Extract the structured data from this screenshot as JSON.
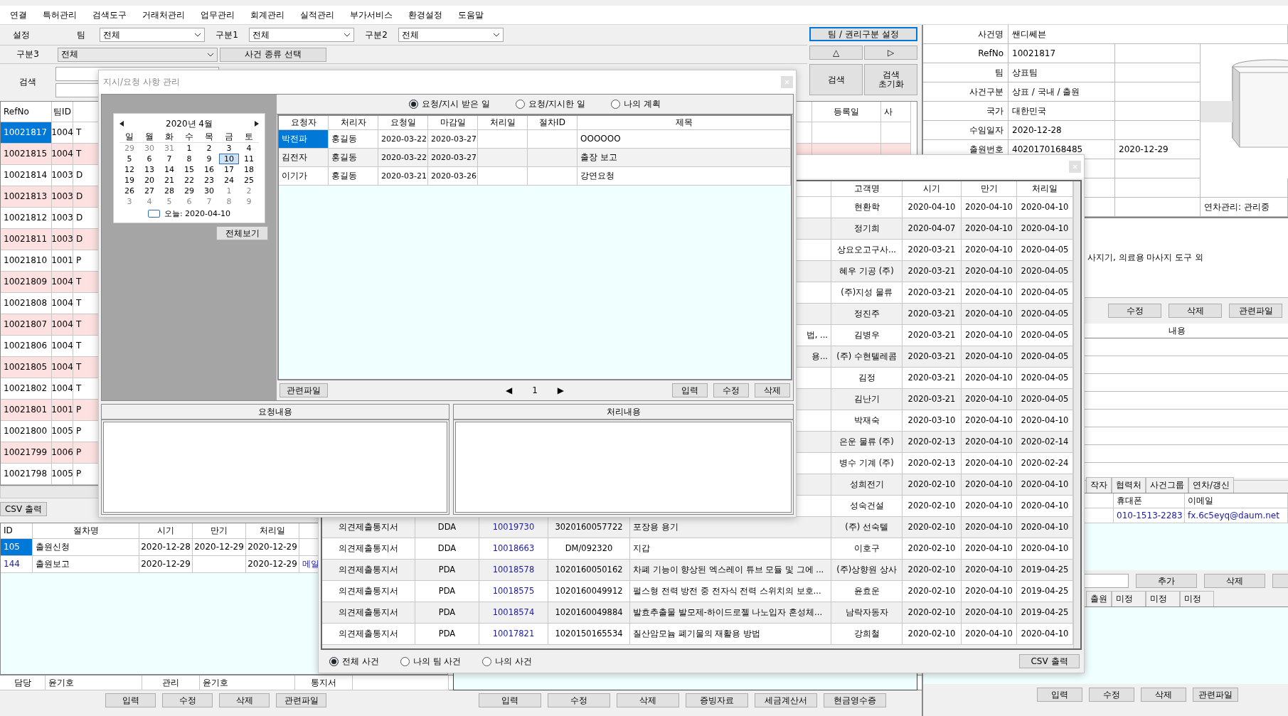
{
  "menu": [
    "연결",
    "특허관리",
    "검색도구",
    "거래처관리",
    "업무관리",
    "회계관리",
    "실적관리",
    "부가서비스",
    "환경설정",
    "도움말"
  ],
  "filters": {
    "settings_label": "설정",
    "team_label": "팀",
    "team_value": "전체",
    "cat1_label": "구분1",
    "cat1_value": "전체",
    "cat2_label": "구분2",
    "cat2_value": "전체",
    "cat3_label": "구분3",
    "cat3_value": "전체",
    "case_type_button": "사건 종류 선택",
    "search_label": "검색"
  },
  "toolbar": {
    "team_rights_button": "팀 / 권리구분 설정",
    "up_button": "△",
    "next_button": "▷",
    "search_button": "검색",
    "reset_button": "검색 초기화"
  },
  "case_table": {
    "columns": [
      "RefNo",
      "팀ID"
    ],
    "right_columns": [
      "등록일",
      "사"
    ],
    "rows": [
      {
        "ref": "10021817",
        "team": "1004",
        "type": "T",
        "selected": true
      },
      {
        "ref": "10021815",
        "team": "1004",
        "type": "T",
        "selected": false
      },
      {
        "ref": "10021814",
        "team": "1003",
        "type": "D",
        "selected": false
      },
      {
        "ref": "10021813",
        "team": "1003",
        "type": "D",
        "selected": false
      },
      {
        "ref": "10021812",
        "team": "1003",
        "type": "D",
        "selected": false
      },
      {
        "ref": "10021811",
        "team": "1003",
        "type": "D",
        "selected": false
      },
      {
        "ref": "10021810",
        "team": "1001",
        "type": "P",
        "selected": false
      },
      {
        "ref": "10021809",
        "team": "1004",
        "type": "T",
        "selected": false
      },
      {
        "ref": "10021808",
        "team": "1004",
        "type": "T",
        "selected": false
      },
      {
        "ref": "10021807",
        "team": "1004",
        "type": "T",
        "selected": false
      },
      {
        "ref": "10021806",
        "team": "1004",
        "type": "T",
        "selected": false
      },
      {
        "ref": "10021805",
        "team": "1004",
        "type": "T",
        "selected": false
      },
      {
        "ref": "10021802",
        "team": "1004",
        "type": "T",
        "selected": false
      },
      {
        "ref": "10021801",
        "team": "1001",
        "type": "P",
        "selected": false
      },
      {
        "ref": "10021800",
        "team": "1005",
        "type": "P",
        "selected": false
      },
      {
        "ref": "10021799",
        "team": "1006",
        "type": "P",
        "selected": false
      },
      {
        "ref": "10021798",
        "team": "1005",
        "type": "P",
        "selected": false
      }
    ]
  },
  "csv_button": "CSV 출력",
  "procedures": {
    "columns": [
      "ID",
      "절차명",
      "시기",
      "만기",
      "처리일"
    ],
    "rows": [
      {
        "id": "105",
        "name": "출원신청",
        "start": "2020-12-28",
        "due": "2020-12-29",
        "done": "2020-12-29",
        "selected": true
      },
      {
        "id": "144",
        "name": "출원보고",
        "start": "2020-12-29",
        "done": "2020-12-29",
        "note": "메일",
        "selected": false
      }
    ]
  },
  "assignment": {
    "owner_label": "담당",
    "owner": "윤기호",
    "manager_label": "관리",
    "manager": "윤기호",
    "notice_label": "통지서"
  },
  "procedure_buttons": [
    "입력",
    "수정",
    "삭제",
    "관련파일"
  ],
  "billing_buttons": [
    "입력",
    "수정",
    "삭제",
    "증빙자료",
    "세금계산서",
    "현금영수증"
  ],
  "case_info": {
    "rows": [
      {
        "label": "사건명",
        "value": "쌘디쎄븐"
      },
      {
        "label": "RefNo",
        "value": "10021817"
      },
      {
        "label": "팀",
        "value": "상표팀"
      },
      {
        "label": "사건구분",
        "value": "상표 / 국내 / 출원"
      },
      {
        "label": "국가",
        "value": "대한민국"
      },
      {
        "label": "수임일자",
        "value": "2020-12-28"
      },
      {
        "label": "출원번호",
        "value": "4020170168485",
        "extra": "2020-12-29"
      }
    ],
    "note": "연차관리: 관리중"
  },
  "description_fragment": "사지기, 의료용 마사지 도구 외",
  "description_buttons": [
    "수정",
    "삭제",
    "관련파일"
  ],
  "content_header": "내용",
  "relation_tabs": [
    "작자",
    "협력처",
    "사건그룹",
    "연차/갱신"
  ],
  "contacts": {
    "columns": [
      "휴대폰",
      "이메일"
    ],
    "rows": [
      {
        "phone": "010-1513-2283",
        "email": "fx.6c5eyq@daum.net"
      }
    ]
  },
  "contact_buttons": [
    "추가",
    "삭제"
  ],
  "status_tabs": [
    "출원",
    "미정",
    "미정",
    "미정"
  ],
  "case_buttons": [
    "입력",
    "수정",
    "삭제",
    "관련파일"
  ],
  "request_dialog": {
    "title": "지시/요청 사항 관리",
    "calendar": {
      "month": "2020년 4월",
      "weekdays": [
        "일",
        "월",
        "화",
        "수",
        "목",
        "금",
        "토"
      ],
      "today": "오늘: 2020-04-10",
      "days": [
        {
          "label": "29",
          "muted": true,
          "selected": false
        },
        {
          "label": "30",
          "muted": true,
          "selected": false
        },
        {
          "label": "31",
          "muted": true,
          "selected": false
        },
        {
          "label": "1",
          "muted": false,
          "selected": false
        },
        {
          "label": "2",
          "muted": false,
          "selected": false
        },
        {
          "label": "3",
          "muted": false,
          "selected": false
        },
        {
          "label": "4",
          "muted": false,
          "selected": false
        },
        {
          "label": "5",
          "muted": false,
          "selected": false
        },
        {
          "label": "6",
          "muted": false,
          "selected": false
        },
        {
          "label": "7",
          "muted": false,
          "selected": false
        },
        {
          "label": "8",
          "muted": false,
          "selected": false
        },
        {
          "label": "9",
          "muted": false,
          "selected": false
        },
        {
          "label": "10",
          "muted": false,
          "selected": true
        },
        {
          "label": "11",
          "muted": false,
          "selected": false
        },
        {
          "label": "12",
          "muted": false,
          "selected": false
        },
        {
          "label": "13",
          "muted": false,
          "selected": false
        },
        {
          "label": "14",
          "muted": false,
          "selected": false
        },
        {
          "label": "15",
          "muted": false,
          "selected": false
        },
        {
          "label": "16",
          "muted": false,
          "selected": false
        },
        {
          "label": "17",
          "muted": false,
          "selected": false
        },
        {
          "label": "18",
          "muted": false,
          "selected": false
        },
        {
          "label": "19",
          "muted": false,
          "selected": false
        },
        {
          "label": "20",
          "muted": false,
          "selected": false
        },
        {
          "label": "21",
          "muted": false,
          "selected": false
        },
        {
          "label": "22",
          "muted": false,
          "selected": false
        },
        {
          "label": "23",
          "muted": false,
          "selected": false
        },
        {
          "label": "24",
          "muted": false,
          "selected": false
        },
        {
          "label": "25",
          "muted": false,
          "selected": false
        },
        {
          "label": "26",
          "muted": false,
          "selected": false
        },
        {
          "label": "27",
          "muted": false,
          "selected": false
        },
        {
          "label": "28",
          "muted": false,
          "selected": false
        },
        {
          "label": "29",
          "muted": false,
          "selected": false
        },
        {
          "label": "30",
          "muted": false,
          "selected": false
        },
        {
          "label": "1",
          "muted": true,
          "selected": false
        },
        {
          "label": "2",
          "muted": true,
          "selected": false
        },
        {
          "label": "3",
          "muted": true,
          "selected": false
        },
        {
          "label": "4",
          "muted": true,
          "selected": false
        },
        {
          "label": "5",
          "muted": true,
          "selected": false
        },
        {
          "label": "6",
          "muted": true,
          "selected": false
        },
        {
          "label": "7",
          "muted": true,
          "selected": false
        },
        {
          "label": "8",
          "muted": true,
          "selected": false
        },
        {
          "label": "9",
          "muted": true,
          "selected": false
        }
      ]
    },
    "all_button": "전체보기",
    "radios": [
      {
        "label": "요청/지시 받은 일",
        "selected": true
      },
      {
        "label": "요청/지시한 일",
        "selected": false
      },
      {
        "label": "나의 계획",
        "selected": false
      }
    ],
    "columns": [
      "요청자",
      "처리자",
      "요청일",
      "마감일",
      "처리일",
      "절차ID",
      "제목"
    ],
    "rows": [
      {
        "requester": "박전파",
        "handler": "홍길동",
        "requested": "2020-03-22",
        "deadline": "2020-03-27",
        "title": "OOOOOO",
        "selected": true
      },
      {
        "requester": "김전자",
        "handler": "홍길동",
        "requested": "2020-03-22",
        "deadline": "2020-03-27",
        "title": "출장 보고",
        "selected": false
      },
      {
        "requester": "이기가",
        "handler": "홍길동",
        "requested": "2020-03-21",
        "deadline": "2020-03-26",
        "title": "강연요청",
        "selected": false
      }
    ],
    "file_button": "관련파일",
    "pager": {
      "prev": "◀",
      "page": "1",
      "next": "▶"
    },
    "actions": [
      "입력",
      "수정",
      "삭제"
    ],
    "panels": [
      "요청내용",
      "처리내용"
    ]
  },
  "deadline_dialog": {
    "columns": [
      "고객명",
      "시기",
      "만기",
      "처리일"
    ],
    "rows": [
      {
        "kind": "partial",
        "customer": "현환학",
        "start": "2020-04-10",
        "due": "2020-04-10",
        "done": "2020-04-10"
      },
      {
        "kind": "partial",
        "customer": "정기희",
        "start": "2020-04-07",
        "due": "2020-04-10",
        "done": "2020-04-10"
      },
      {
        "kind": "partial",
        "customer": "상요오고구사...",
        "start": "2020-03-21",
        "due": "2020-04-10",
        "done": "2020-04-05"
      },
      {
        "kind": "partial",
        "customer": "혜우 기공 (주)",
        "start": "2020-03-21",
        "due": "2020-04-10",
        "done": "2020-04-05"
      },
      {
        "kind": "partial",
        "customer": "(주)지성 물류",
        "start": "2020-03-21",
        "due": "2020-04-10",
        "done": "2020-04-05"
      },
      {
        "kind": "partial",
        "customer": "정진주",
        "start": "2020-03-21",
        "due": "2020-04-10",
        "done": "2020-04-05"
      },
      {
        "kind": "partial",
        "title": "법, ...",
        "customer": "김병우",
        "start": "2020-03-21",
        "due": "2020-04-10",
        "done": "2020-04-05"
      },
      {
        "kind": "partial",
        "title": "용...",
        "customer": "(주) 수현텔레콤",
        "start": "2020-03-21",
        "due": "2020-04-10",
        "done": "2020-04-05"
      },
      {
        "kind": "partial",
        "customer": "김정",
        "start": "2020-03-21",
        "due": "2020-04-10",
        "done": "2020-04-05"
      },
      {
        "kind": "partial",
        "customer": "김난기",
        "start": "2020-03-21",
        "due": "2020-04-10",
        "done": "2020-04-05"
      },
      {
        "kind": "partial",
        "customer": "박재숙",
        "start": "2020-03-10",
        "due": "2020-04-10",
        "done": "2020-04-10"
      },
      {
        "kind": "partial",
        "customer": "은운 물류 (주)",
        "start": "2020-02-13",
        "due": "2020-04-10",
        "done": "2020-02-14"
      },
      {
        "kind": "partial",
        "customer": "병수 기계 (주)",
        "start": "2020-02-13",
        "due": "2020-04-10",
        "done": "2020-02-24"
      },
      {
        "kind": "partial",
        "customer": "성희전기",
        "start": "2020-02-10",
        "due": "2020-04-10",
        "done": "2020-04-10"
      },
      {
        "kind": "partial",
        "customer": "성숙건설",
        "start": "2020-02-10",
        "due": "2020-04-10",
        "done": "2020-04-10"
      },
      {
        "kind": "full",
        "type": "의견제출통지서",
        "code": "DDA",
        "ref": "10019730",
        "appno": "3020160057722",
        "title": "포장용 용기",
        "customer": "(주) 선숙텔",
        "start": "2020-02-10",
        "due": "2020-04-10",
        "done": "2020-04-10"
      },
      {
        "kind": "full",
        "type": "의견제출통지서",
        "code": "DDA",
        "ref": "10018663",
        "appno": "DM/092320",
        "title": "지갑",
        "customer": "이호구",
        "start": "2020-02-10",
        "due": "2020-04-10",
        "done": "2020-04-10"
      },
      {
        "kind": "full",
        "type": "의견제출통지서",
        "code": "PDA",
        "ref": "10018578",
        "appno": "1020160050162",
        "title": "차폐 기능이 향상된 엑스레이 튜브 모듈 및 그에 ...",
        "customer": "(주)상향원 상사",
        "start": "2020-02-10",
        "due": "2020-04-10",
        "done": "2019-04-25"
      },
      {
        "kind": "full",
        "type": "의견제출통지서",
        "code": "PDA",
        "ref": "10018575",
        "appno": "1020160049912",
        "title": "펄스형 전력 방전 중 전자식 전력 스위치의 보호...",
        "customer": "윤효운",
        "start": "2020-02-10",
        "due": "2020-04-10",
        "done": "2019-04-25"
      },
      {
        "kind": "full",
        "type": "의견제출통지서",
        "code": "PDA",
        "ref": "10018574",
        "appno": "1020160049884",
        "title": "발효추출물 발모제-하이드로젤 나노입자 혼성체...",
        "customer": "남락자동자",
        "start": "2020-02-10",
        "due": "2020-04-10",
        "done": "2019-04-25"
      },
      {
        "kind": "full",
        "type": "의견제출통지서",
        "code": "PDA",
        "ref": "10017821",
        "appno": "1020150165534",
        "title": "질산암모늄 폐기물의 재활용 방법",
        "customer": "강희철",
        "start": "2020-02-10",
        "due": "2020-04-10",
        "done": "2020-04-10"
      }
    ],
    "radios": [
      {
        "label": "전체 사건",
        "selected": true
      },
      {
        "label": "나의 팀 사건",
        "selected": false
      },
      {
        "label": "나의 사건",
        "selected": false
      }
    ],
    "csv_button": "CSV 출력"
  }
}
